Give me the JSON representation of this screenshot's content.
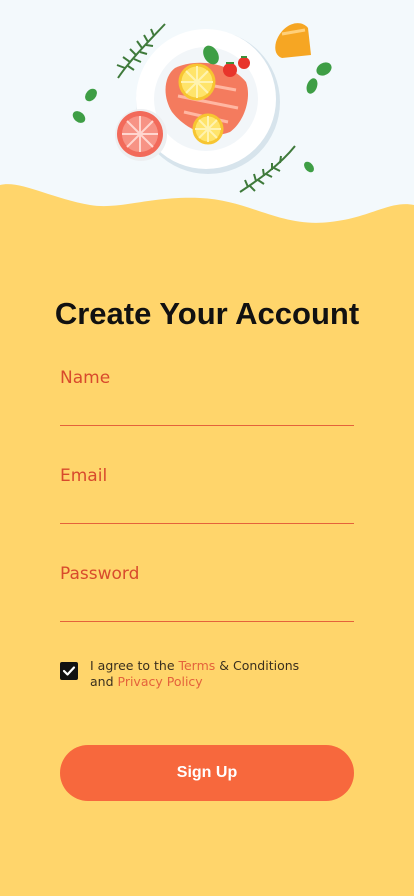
{
  "screen": {
    "title": "Create Your Account"
  },
  "form": {
    "name": {
      "label": "Name",
      "value": "",
      "placeholder": ""
    },
    "email": {
      "label": "Email",
      "value": "",
      "placeholder": ""
    },
    "password": {
      "label": "Password",
      "value": "",
      "placeholder": ""
    }
  },
  "terms": {
    "checked": true,
    "prefix": "I agree to the ",
    "terms_link": "Terms",
    "middle": " & Conditions",
    "and_word": "and ",
    "privacy_link": "Privacy Policy"
  },
  "actions": {
    "signup_label": "Sign Up"
  },
  "hero": {
    "illustration": "salmon-plate-illustration"
  },
  "colors": {
    "background": "#FFD56B",
    "accent": "#F7683D",
    "label": "#D84A2C",
    "hero_background": "#F3F9FC"
  }
}
